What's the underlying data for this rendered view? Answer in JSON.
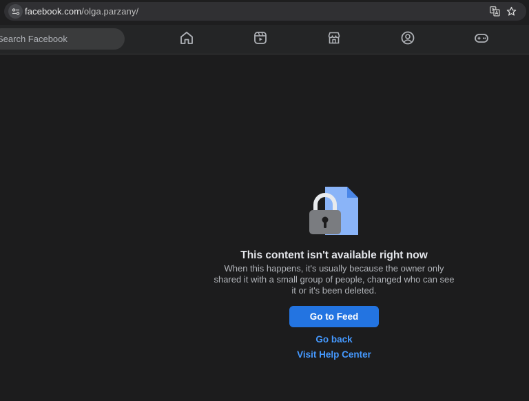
{
  "browser": {
    "url_host": "facebook.com",
    "url_path": "/olga.parzany/",
    "icons": [
      "site-info-icon",
      "translate-icon",
      "bookmark-star-icon"
    ]
  },
  "nav": {
    "search_placeholder": "Search Facebook",
    "tabs": [
      {
        "name": "home",
        "icon": "home-icon"
      },
      {
        "name": "video",
        "icon": "video-icon"
      },
      {
        "name": "marketplace",
        "icon": "marketplace-icon"
      },
      {
        "name": "groups",
        "icon": "groups-icon"
      },
      {
        "name": "gaming",
        "icon": "gaming-icon"
      }
    ]
  },
  "error": {
    "icon": "locked-document-icon",
    "title": "This content isn't available right now",
    "description": "When this happens, it's usually because the owner only shared it with a small group of people, changed who can see it or it's been deleted.",
    "primary_button": "Go to Feed",
    "back_link": "Go back",
    "help_link": "Visit Help Center"
  },
  "colors": {
    "background": "#1c1c1d",
    "nav_background": "#242526",
    "accent": "#2374e1",
    "link": "#4599ff"
  }
}
